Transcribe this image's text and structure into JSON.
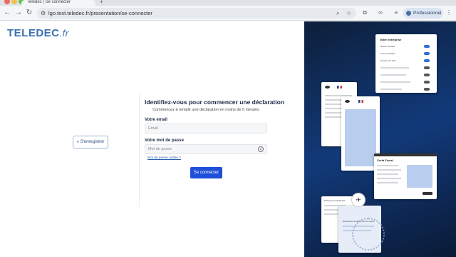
{
  "browser": {
    "tab_title": "Teledec | Se connecter",
    "new_tab": "+",
    "url": "lgo.test.teledec.fr/presentation/se-connecter",
    "profile_label": "Professionnel"
  },
  "page": {
    "logo_text": "TELEDEC",
    "logo_suffix": ".fr",
    "register_label": "S'enregistrer",
    "title": "Identifiez-vous pour commencer une déclaration",
    "subtitle": "Commencez à remplir une déclaration en moins de 5 minutes",
    "email_label": "Votre email",
    "email_placeholder": "Email",
    "password_label": "Votre mot de passe",
    "password_placeholder": "Mot de passe",
    "forgot_label": "Mot de passe oublié ?",
    "submit_label": "Se connecter"
  },
  "panel": {
    "settings_card_title": "Votre entreprise",
    "settings_rows": [
      "Raison Sociale",
      "Forme juridique",
      "Numéro de TVA"
    ],
    "form_card_title": "Cerfa Fiscal",
    "bottom_card_title": "Récépissé de dépôt des comptes",
    "left_doc_label": "Entreprise Individuelle"
  },
  "colors": {
    "brand": "#3a6fb0",
    "primary_button": "#1f4fd8",
    "panel_dark": "#0d1f3a",
    "panel_accent": "#123a7a"
  }
}
